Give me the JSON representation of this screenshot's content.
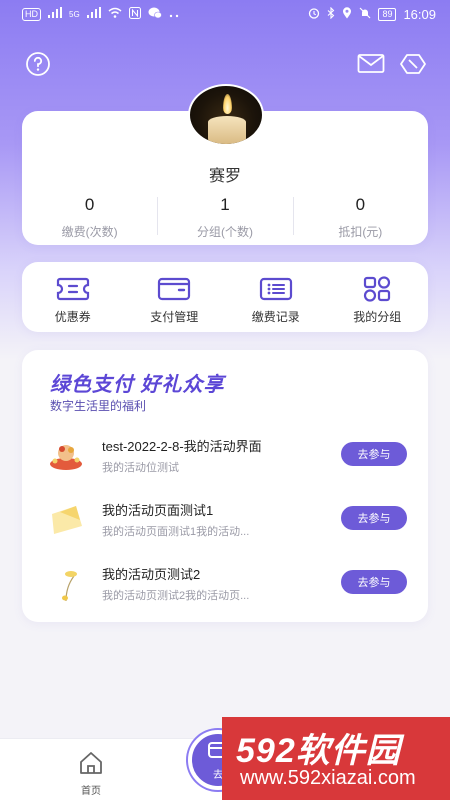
{
  "status_bar": {
    "left_badges": [
      "HD",
      "5G"
    ],
    "time": "16:09",
    "battery": "89"
  },
  "profile": {
    "username": "赛罗",
    "stats": [
      {
        "value": "0",
        "label": "缴费(次数)"
      },
      {
        "value": "1",
        "label": "分组(个数)"
      },
      {
        "value": "0",
        "label": "抵扣(元)"
      }
    ]
  },
  "menu": [
    {
      "label": "优惠券",
      "icon": "coupon-icon"
    },
    {
      "label": "支付管理",
      "icon": "wallet-icon"
    },
    {
      "label": "缴费记录",
      "icon": "record-list-icon"
    },
    {
      "label": "我的分组",
      "icon": "group-grid-icon"
    }
  ],
  "promo": {
    "title": "绿色支付  好礼众享",
    "subtitle": "数字生活里的福利",
    "activities": [
      {
        "title": "test-2022-2-8-我的活动界面",
        "desc": "我的活动位测试",
        "button": "去参与"
      },
      {
        "title": "我的活动页面测试1",
        "desc": "我的活动页面测试1我的活动...",
        "button": "去参与"
      },
      {
        "title": "我的活动页测试2",
        "desc": "我的活动页测试2我的活动页...",
        "button": "去参与"
      }
    ]
  },
  "bottom_nav": {
    "home_label": "首页",
    "center_label": "去"
  },
  "watermark": {
    "big": "592软件园",
    "small": "www.592xiazai.com"
  },
  "colors": {
    "accent": "#6d5bd8",
    "header_gradient_top": "#8c7cf2",
    "watermark": "#d8383a"
  }
}
